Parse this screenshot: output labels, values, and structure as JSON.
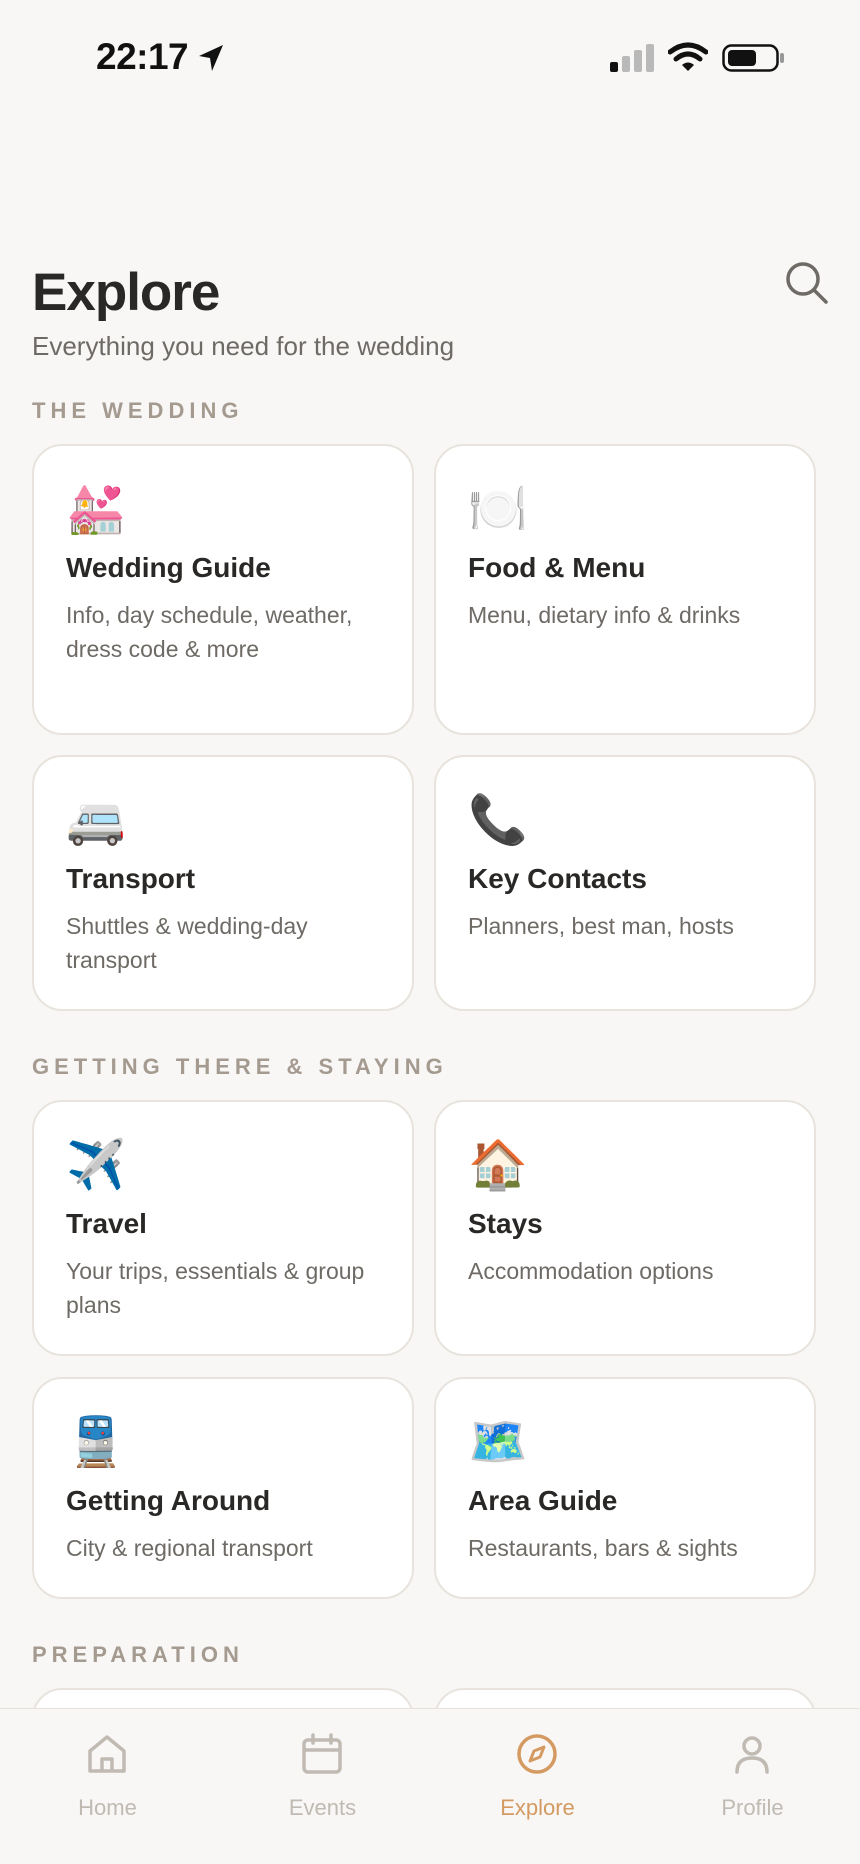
{
  "status_bar": {
    "time": "22:17"
  },
  "header": {
    "title": "Explore",
    "subtitle": "Everything you need for the wedding",
    "search_icon": "search-icon"
  },
  "sections": [
    {
      "title": "THE WEDDING",
      "cards": [
        {
          "icon": "wedding-icon",
          "emoji": "💒",
          "title": "Wedding Guide",
          "description": "Info, day schedule, weather, dress code & more"
        },
        {
          "icon": "plate-icon",
          "emoji": "🍽️",
          "title": "Food & Menu",
          "description": "Menu, dietary info & drinks"
        },
        {
          "icon": "minibus-icon",
          "emoji": "🚐",
          "title": "Transport",
          "description": "Shuttles & wedding-day transport"
        },
        {
          "icon": "phone-icon",
          "emoji": "📞",
          "title": "Key Contacts",
          "description": "Planners, best man, hosts"
        }
      ]
    },
    {
      "title": "GETTING THERE & STAYING",
      "cards": [
        {
          "icon": "airplane-icon",
          "emoji": "✈️",
          "title": "Travel",
          "description": "Your trips, essentials & group plans"
        },
        {
          "icon": "house-icon",
          "emoji": "🏠",
          "title": "Stays",
          "description": "Accommodation options"
        },
        {
          "icon": "train-icon",
          "emoji": "🚆",
          "title": "Getting Around",
          "description": "City & regional transport"
        },
        {
          "icon": "map-icon",
          "emoji": "🗺️",
          "title": "Area Guide",
          "description": "Restaurants, bars & sights"
        }
      ]
    },
    {
      "title": "PREPARATION",
      "cards": []
    }
  ],
  "bottom_nav": {
    "items": [
      {
        "label": "Home",
        "icon": "home-icon",
        "active": false
      },
      {
        "label": "Events",
        "icon": "calendar-icon",
        "active": false
      },
      {
        "label": "Explore",
        "icon": "compass-icon",
        "active": true
      },
      {
        "label": "Profile",
        "icon": "person-icon",
        "active": false
      }
    ]
  },
  "colors": {
    "background": "#f8f7f5",
    "accent": "#d49a62",
    "section_title": "#a49a90",
    "card_border": "#e8e3dd",
    "inactive_nav": "#c0bab3"
  }
}
